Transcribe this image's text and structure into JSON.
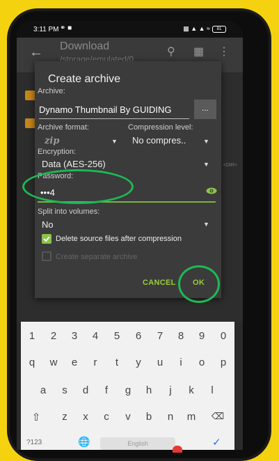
{
  "status": {
    "time": "3:11 PM",
    "battery": "81"
  },
  "appbar": {
    "title": "Download",
    "path": "/storage/emulated/0..."
  },
  "dir_label": "<DIR>",
  "dialog": {
    "title": "Create archive",
    "archive_label": "Archive:",
    "archive_value": "Dynamo Thumbnail By GUIDING",
    "browse_label": "...",
    "format_label": "Archive format:",
    "format_value": "zip",
    "compression_label": "Compression level:",
    "compression_value": "No compres..",
    "encryption_label": "Encryption:",
    "encryption_value": "Data (AES-256)",
    "password_label": "Password:",
    "password_value": "•••4",
    "split_label": "Split into volumes:",
    "split_value": "No",
    "delete_source_label": "Delete source files after compression",
    "delete_source_checked": true,
    "separate_label": "Create separate archive",
    "separate_checked": false,
    "cancel_label": "CANCEL",
    "ok_label": "OK"
  },
  "keyboard": {
    "row_numbers": [
      "1",
      "2",
      "3",
      "4",
      "5",
      "6",
      "7",
      "8",
      "9",
      "0"
    ],
    "row1": [
      "q",
      "w",
      "e",
      "r",
      "t",
      "y",
      "u",
      "i",
      "o",
      "p"
    ],
    "row2": [
      "a",
      "s",
      "d",
      "f",
      "g",
      "h",
      "j",
      "k",
      "l"
    ],
    "row3": [
      "z",
      "x",
      "c",
      "v",
      "b",
      "n",
      "m"
    ],
    "symbols_key": "?123",
    "space_label": "English"
  },
  "colors": {
    "accent": "#8bc34a",
    "annotation": "#1db954",
    "background": "#f5d20f"
  }
}
